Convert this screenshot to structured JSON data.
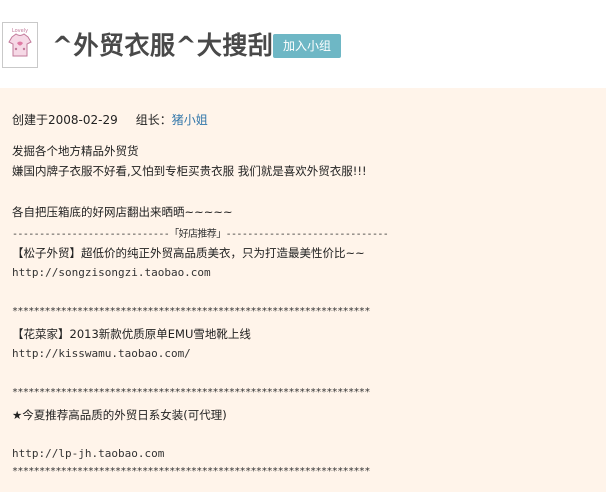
{
  "header": {
    "title": "^外贸衣服^大搜刮",
    "join_label": "加入小组",
    "logo_icon": "tshirt-logo-icon"
  },
  "meta": {
    "created_label": "创建于2008-02-29",
    "leader_label": "组长：",
    "leader_name": "猪小姐"
  },
  "description": {
    "lines": [
      "发掘各个地方精品外贸货",
      "嫌国内牌子衣服不好看,又怕到专柜买贵衣服 我们就是喜欢外贸衣服!!!",
      "各自把压箱底的好网店翻出来晒晒~~~~~",
      "-----------------------------「好店推荐」------------------------------",
      "【松子外贸】超低价的纯正外贸高品质美衣，只为打造最美性价比~~",
      "http://songzisongzi.taobao.com",
      "******************************************************************",
      "【花菜家】2013新款优质原单EMU雪地靴上线",
      "http://kisswamu.taobao.com/",
      "******************************************************************",
      "★今夏推荐高品质的外贸日系女装(可代理)",
      "http://lp-jh.taobao.com",
      "******************************************************************"
    ]
  },
  "colors": {
    "panel_bg": "#fff4ea",
    "button_bg": "#6eb7c5",
    "link": "#3377aa"
  }
}
